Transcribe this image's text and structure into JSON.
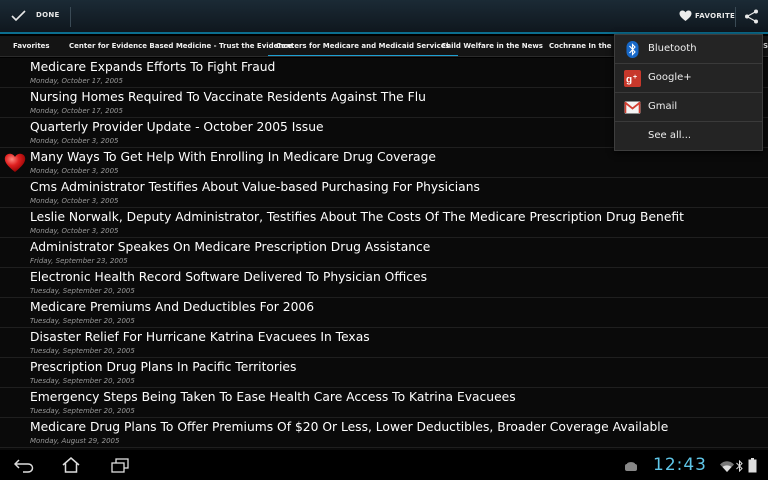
{
  "action_bar": {
    "done_label": "DONE",
    "favorite_label": "FAVORITE"
  },
  "tabs": [
    {
      "label": "Favorites"
    },
    {
      "label": "Center for Evidence Based Medicine - Trust the Evidence"
    },
    {
      "label": "Centers for Medicare and Medicaid Services",
      "active": true
    },
    {
      "label": "Child Welfare in the News"
    },
    {
      "label": "Cochrane In the New"
    },
    {
      "label": "S"
    }
  ],
  "articles": [
    {
      "title": "Medicare Expands Efforts To Fight Fraud",
      "date": "Monday, October 17, 2005"
    },
    {
      "title": "Nursing Homes Required To Vaccinate Residents Against The Flu",
      "date": "Monday, October 17, 2005"
    },
    {
      "title": "Quarterly Provider Update - October 2005 Issue",
      "date": "Monday, October 3, 2005"
    },
    {
      "title": "Many Ways To Get Help With Enrolling In Medicare Drug Coverage",
      "date": "Monday, October 3, 2005",
      "favorited": true
    },
    {
      "title": "Cms Administrator Testifies About Value-based Purchasing For Physicians",
      "date": "Monday, October 3, 2005"
    },
    {
      "title": "Leslie Norwalk, Deputy Administrator, Testifies About The Costs Of The Medicare Prescription Drug Benefit",
      "date": "Monday, October 3, 2005"
    },
    {
      "title": "Administrator Speakes On Medicare Prescription Drug Assistance",
      "date": "Friday, September 23, 2005"
    },
    {
      "title": "Electronic Health Record Software Delivered To Physician Offices",
      "date": "Tuesday, September 20, 2005"
    },
    {
      "title": "Medicare Premiums And Deductibles For 2006",
      "date": "Tuesday, September 20, 2005"
    },
    {
      "title": "Disaster Relief For Hurricane Katrina Evacuees In Texas",
      "date": "Tuesday, September 20, 2005"
    },
    {
      "title": "Prescription Drug Plans In Pacific Territories",
      "date": "Tuesday, September 20, 2005"
    },
    {
      "title": "Emergency Steps Being Taken To Ease Health Care Access To Katrina Evacuees",
      "date": "Tuesday, September 20, 2005"
    },
    {
      "title": "Medicare Drug Plans To Offer Premiums Of $20 Or Less, Lower Deductibles, Broader Coverage Available",
      "date": "Monday, August 29, 2005"
    }
  ],
  "share_menu": {
    "items": [
      {
        "label": "Bluetooth",
        "icon": "bluetooth-icon"
      },
      {
        "label": "Google+",
        "icon": "google-plus-icon"
      },
      {
        "label": "Gmail",
        "icon": "gmail-icon"
      },
      {
        "label": "See all...",
        "icon": ""
      }
    ]
  },
  "status_bar": {
    "time": "12:43"
  },
  "colors": {
    "accent": "#1d9fd2",
    "clock": "#5fc6e8",
    "heart": "#e02020"
  }
}
